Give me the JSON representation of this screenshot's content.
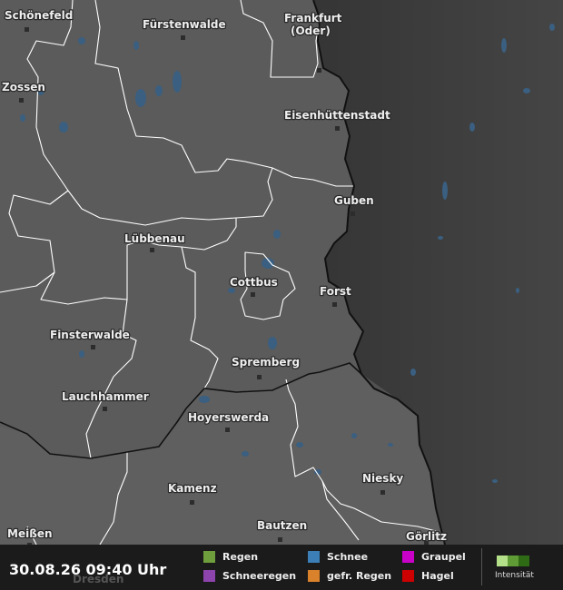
{
  "map": {
    "cities": [
      {
        "name": "Schönefeld"
      },
      {
        "name": "Fürstenwalde"
      },
      {
        "name": "Frankfurt"
      },
      {
        "name": "(Oder)"
      },
      {
        "name": "Zossen"
      },
      {
        "name": "Eisenhüttenstadt"
      },
      {
        "name": "Guben"
      },
      {
        "name": "Lübbenau"
      },
      {
        "name": "Cottbus"
      },
      {
        "name": "Forst"
      },
      {
        "name": "Finsterwalde"
      },
      {
        "name": "Spremberg"
      },
      {
        "name": "Lauchhammer"
      },
      {
        "name": "Hoyerswerda"
      },
      {
        "name": "Niesky"
      },
      {
        "name": "Kamenz"
      },
      {
        "name": "Bautzen"
      },
      {
        "name": "Meißen"
      },
      {
        "name": "Görlitz"
      },
      {
        "name": "Dresden"
      }
    ]
  },
  "legend": {
    "timestamp": "30.08.26 09:40 Uhr",
    "items": [
      {
        "label": "Regen",
        "color": "#6f9e3c"
      },
      {
        "label": "Schneeregen",
        "color": "#8e44ad"
      },
      {
        "label": "Schnee",
        "color": "#3b7fb6"
      },
      {
        "label": "gefr. Regen",
        "color": "#d9822b"
      },
      {
        "label": "Graupel",
        "color": "#c800c8"
      },
      {
        "label": "Hagel",
        "color": "#cc0000"
      }
    ],
    "intensity_label": "Intensität",
    "intensity_colors": [
      "#b5e08a",
      "#5f9c35",
      "#2f6a14"
    ]
  },
  "colors": {
    "land_germany": "#5a5a5a",
    "land_poland": "#3a3a3a",
    "water": "#3a5f80",
    "border": "#ffffff",
    "country_border": "#111111"
  }
}
